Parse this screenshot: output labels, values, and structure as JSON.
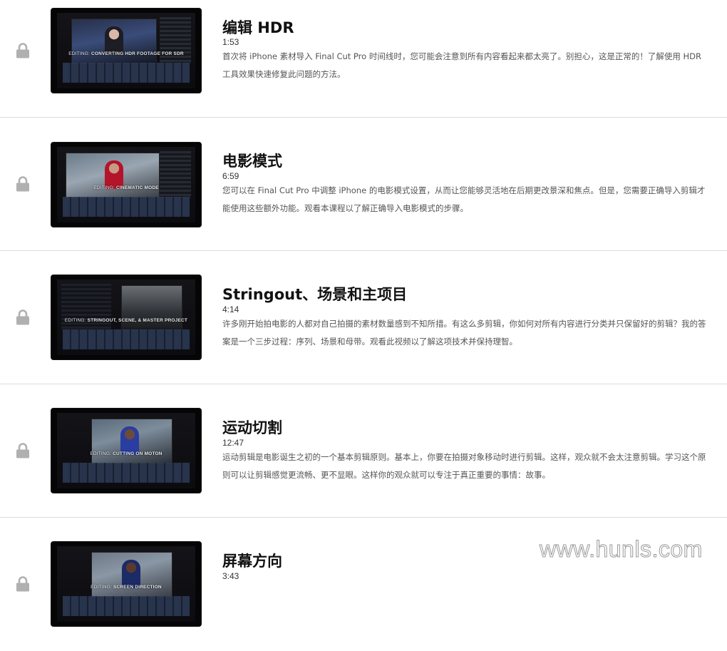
{
  "lessons": [
    {
      "title": "编辑 HDR",
      "duration": "1:53",
      "description": "首次将 iPhone 素材导入 Final Cut Pro 时间线时，您可能会注意到所有内容看起来都太亮了。别担心，这是正常的！了解使用 HDR 工具效果快速修复此问题的方法。",
      "thumbnail_caption_prefix": "EDITING:",
      "thumbnail_caption": "CONVERTING HDR FOOTAGE FOR SDR",
      "locked_icon": "lock-icon"
    },
    {
      "title": "电影模式",
      "duration": "6:59",
      "description": "您可以在 Final Cut Pro 中调整 iPhone 的电影模式设置，从而让您能够灵活地在后期更改景深和焦点。但是，您需要正确导入剪辑才能使用这些额外功能。观看本课程以了解正确导入电影模式的步骤。",
      "thumbnail_caption_prefix": "EDITING:",
      "thumbnail_caption": "CINEMATIC MODE",
      "locked_icon": "lock-icon"
    },
    {
      "title": "Stringout、场景和主项目",
      "duration": "4:14",
      "description": "许多刚开始拍电影的人都对自己拍摄的素材数量感到不知所措。有这么多剪辑，你如何对所有内容进行分类并只保留好的剪辑？我的答案是一个三步过程：序列、场景和母带。观看此视频以了解这项技术并保持理智。",
      "thumbnail_caption_prefix": "EDITING:",
      "thumbnail_caption": "STRINGOUT, SCENE, & MASTER PROJECT",
      "locked_icon": "lock-icon"
    },
    {
      "title": "运动切割",
      "duration": "12:47",
      "description": "运动剪辑是电影诞生之初的一个基本剪辑原则。基本上，你要在拍摄对象移动时进行剪辑。这样，观众就不会太注意剪辑。学习这个原则可以让剪辑感觉更流畅、更不显眼。这样你的观众就可以专注于真正重要的事情：故事。",
      "thumbnail_caption_prefix": "EDITING:",
      "thumbnail_caption": "CUTTING ON MOTON",
      "locked_icon": "lock-icon"
    },
    {
      "title": "屏幕方向",
      "duration": "3:43",
      "description": "",
      "thumbnail_caption_prefix": "EDITING:",
      "thumbnail_caption": "SCREEN DIRECTION",
      "locked_icon": "lock-icon"
    }
  ],
  "watermark": "www.hunls.com",
  "colors": {
    "lock": "#b0b0b0",
    "divider": "#dcdcdc",
    "title": "#111111",
    "description": "#555555"
  }
}
